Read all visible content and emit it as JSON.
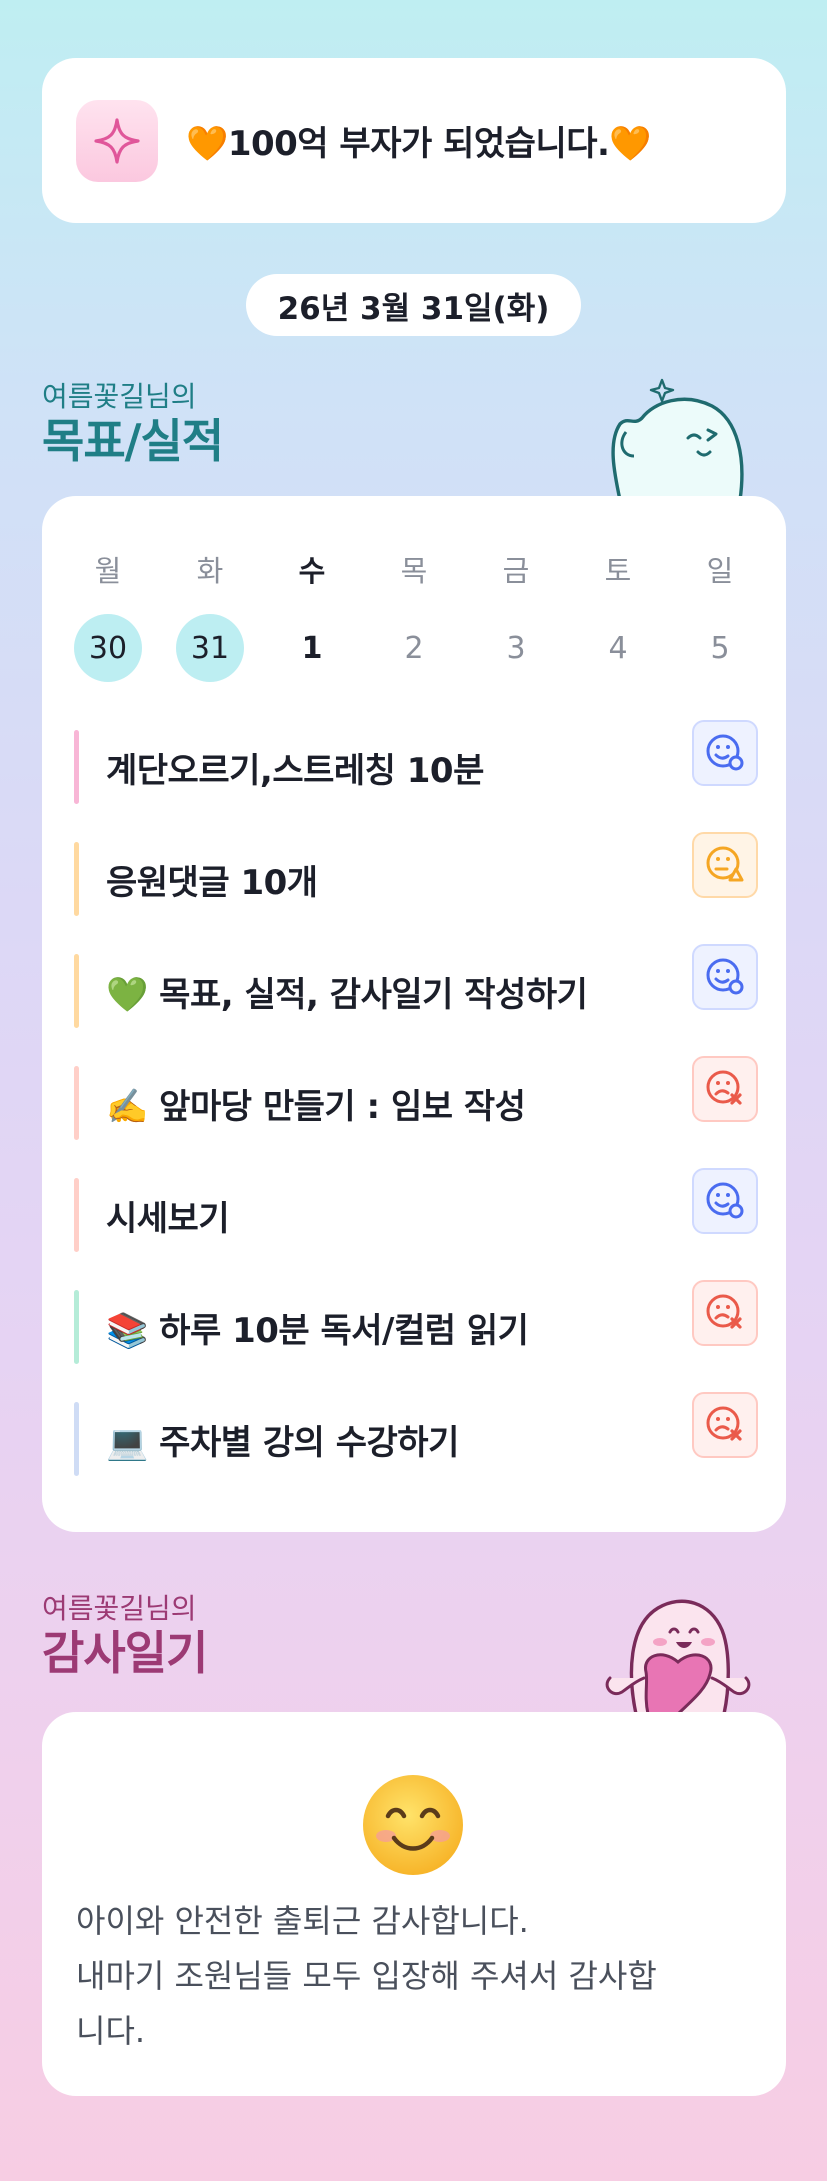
{
  "goal_banner": {
    "text": "🧡100억 부자가 되었습니다.🧡",
    "icon": "sparkle-icon"
  },
  "date": "26년 3월 31일(화)",
  "goals_section": {
    "owner": "여름꽃길님의",
    "title": "목표/실적"
  },
  "week": {
    "days": [
      "월",
      "화",
      "수",
      "목",
      "금",
      "토",
      "일"
    ],
    "dates": [
      "30",
      "31",
      "1",
      "2",
      "3",
      "4",
      "5"
    ],
    "completed_dates": [
      "30",
      "31"
    ],
    "today": "1"
  },
  "goals": [
    {
      "text": "계단오르기,스트레칭 10분",
      "bar_color": "#f8b6d6",
      "status": "done"
    },
    {
      "text": "응원댓글 10개",
      "bar_color": "#ffd9a0",
      "status": "partial"
    },
    {
      "text": "💚 목표, 실적, 감사일기 작성하기",
      "bar_color": "#ffd9a0",
      "status": "done"
    },
    {
      "text": "✍️ 앞마당 만들기 : 임보 작성",
      "bar_color": "#ffcfc8",
      "status": "fail"
    },
    {
      "text": "시세보기",
      "bar_color": "#ffcfc8",
      "status": "done"
    },
    {
      "text": "📚 하루 10분 독서/컬럼 읽기",
      "bar_color": "#b5ecd8",
      "status": "fail"
    },
    {
      "text": "💻 주차별 강의 수강하기",
      "bar_color": "#cfdcf5",
      "status": "fail"
    }
  ],
  "gratitude_section": {
    "owner": "여름꽃길님의",
    "title": "감사일기"
  },
  "gratitude": {
    "emoji": "smiling-face-icon",
    "line1": "아이와 안전한 출퇴근 감사합니다.",
    "line2": "내마기 조원님들 모두 입장해 주셔서 감사합",
    "line3": "니다."
  },
  "colors": {
    "teal_heading": "#1f7e86",
    "plum_heading": "#9c3a74",
    "done_blue": "#4a6cf0",
    "partial_orange": "#f5a623",
    "fail_red": "#ea5a4a"
  }
}
